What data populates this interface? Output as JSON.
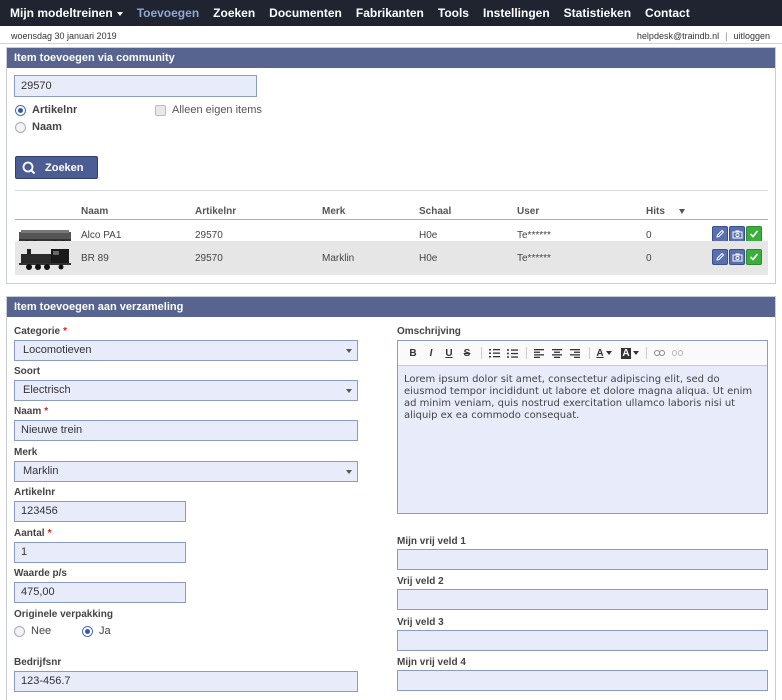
{
  "nav": {
    "items": [
      "Mijn modeltreinen",
      "Toevoegen",
      "Zoeken",
      "Documenten",
      "Fabrikanten",
      "Tools",
      "Instellingen",
      "Statistieken",
      "Contact"
    ]
  },
  "infobar": {
    "date": "woensdag 30 januari 2019",
    "email": "helpdesk@traindb.nl",
    "separator": "|",
    "logout": "uitloggen"
  },
  "community": {
    "title": "Item toevoegen via community",
    "search_value": "29570",
    "radio_artikelnr": "Artikelnr",
    "radio_naam": "Naam",
    "selected_radio": "Artikelnr",
    "checkbox_own": "Alleen eigen items",
    "search_button": "Zoeken",
    "table": {
      "headers": [
        "Naam",
        "Artikelnr",
        "Merk",
        "Schaal",
        "User",
        "Hits"
      ],
      "rows": [
        {
          "naam": "Alco PA1",
          "artikelnr": "29570",
          "merk": "",
          "schaal": "H0e",
          "user": "Te******",
          "hits": "0"
        },
        {
          "naam": "BR 89",
          "artikelnr": "29570",
          "merk": "Marklin",
          "schaal": "H0e",
          "user": "Te******",
          "hits": "0"
        }
      ]
    }
  },
  "collection": {
    "title": "Item toevoegen aan verzameling",
    "categorie_label": "Categorie",
    "categorie_value": "Locomotieven",
    "soort_label": "Soort",
    "soort_value": "Electrisch",
    "naam_label": "Naam",
    "naam_value": "Nieuwe trein",
    "merk_label": "Merk",
    "merk_value": "Marklin",
    "artikelnr_label": "Artikelnr",
    "artikelnr_value": "123456",
    "aantal_label": "Aantal",
    "aantal_value": "1",
    "waarde_label": "Waarde p/s",
    "waarde_value": "475,00",
    "verpakking_label": "Originele verpakking",
    "verpakking_nee": "Nee",
    "verpakking_ja": "Ja",
    "verpakking_selected": "Ja",
    "bedrijfsnr_label": "Bedrijfsnr",
    "bedrijfsnr_value": "123-456.7",
    "omschrijving_label": "Omschrijving",
    "omschrijving_text": "Lorem ipsum dolor sit amet, consectetur adipiscing elit, sed do eiusmod tempor incididunt ut labore et dolore magna aliqua. Ut enim ad minim veniam, quis nostrud exercitation ullamco laboris nisi ut aliquip ex ea commodo consequat.",
    "toolbar": {
      "bold": "B",
      "italic": "I",
      "underline": "U",
      "strike": "S",
      "font_color": "A",
      "bg_color": "A"
    },
    "vrij1_label": "Mijn vrij veld 1",
    "vrij2_label": "Vrij veld 2",
    "vrij3_label": "Vrij veld 3",
    "vrij4_label": "Mijn vrij veld 4",
    "required_mark": "*"
  },
  "colors": {
    "nav_bg": "#1f2430",
    "nav_active": "#8fa6d6",
    "panel_header": "#56648f",
    "input_bg": "#e8ecfa",
    "input_border": "#8a9cc6",
    "required": "#dd2222",
    "confirm_green": "#3cae3c"
  }
}
